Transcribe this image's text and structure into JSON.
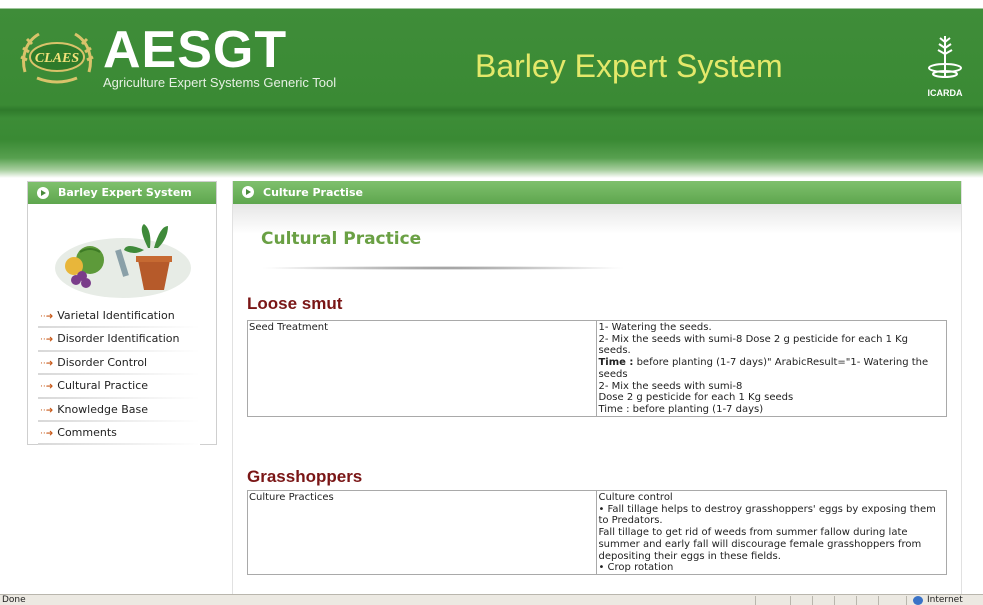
{
  "header": {
    "logo_text": "CLAES",
    "app_title": "AESGT",
    "app_subtitle": "Agriculture Expert Systems Generic Tool",
    "system_title": "Barley Expert System",
    "partner_logo_text": "ICARDA"
  },
  "sidebar": {
    "panel_title": "Barley Expert System",
    "image_alt": "fruits-and-plant-illustration",
    "items": [
      {
        "label": "Varietal Identification"
      },
      {
        "label": "Disorder Identification"
      },
      {
        "label": "Disorder Control"
      },
      {
        "label": "Cultural Practice"
      },
      {
        "label": "Knowledge Base"
      },
      {
        "label": "Comments"
      }
    ]
  },
  "main": {
    "panel_title": "Culture Practise",
    "page_title": "Cultural Practice",
    "sections": [
      {
        "title": "Loose smut",
        "rows": [
          {
            "label": "Seed Treatment",
            "lines": [
              {
                "bold": "",
                "text": "1- Watering the seeds."
              },
              {
                "bold": "",
                "text": "2- Mix the seeds with sumi-8 Dose 2 g pesticide for each 1 Kg"
              },
              {
                "bold": "",
                "text": "seeds."
              },
              {
                "bold": "Time :",
                "text": " before planting (1-7 days)\" ArabicResult=\"1- Watering the"
              },
              {
                "bold": "",
                "text": "seeds"
              },
              {
                "bold": "",
                "text": "2- Mix the seeds with sumi-8"
              },
              {
                "bold": "",
                "text": "Dose 2 g pesticide for each 1 Kg seeds"
              },
              {
                "bold": "",
                "text": "Time : before planting (1-7 days)"
              }
            ]
          }
        ]
      },
      {
        "title": "Grasshoppers",
        "rows": [
          {
            "label": "Culture Practices",
            "lines": [
              {
                "bold": "",
                "text": "Culture control"
              },
              {
                "bold": "",
                "text": "• Fall tillage helps to destroy grasshoppers' eggs by exposing them"
              },
              {
                "bold": "",
                "text": "to Predators."
              },
              {
                "bold": "",
                "text": "Fall tillage to get rid of weeds from summer fallow during late"
              },
              {
                "bold": "",
                "text": "summer and early fall will discourage female grasshoppers from"
              },
              {
                "bold": "",
                "text": "depositing their eggs in these fields."
              },
              {
                "bold": "",
                "text": "• Crop rotation"
              }
            ]
          }
        ]
      }
    ]
  },
  "statusbar": {
    "status_text": "Done",
    "zone_text": "Internet"
  },
  "colors": {
    "header_green": "#3a8a34",
    "panel_green": "#6fb35e",
    "title_green": "#6aa044",
    "section_red": "#7a1616",
    "system_title_yellow": "#e4e86a"
  }
}
